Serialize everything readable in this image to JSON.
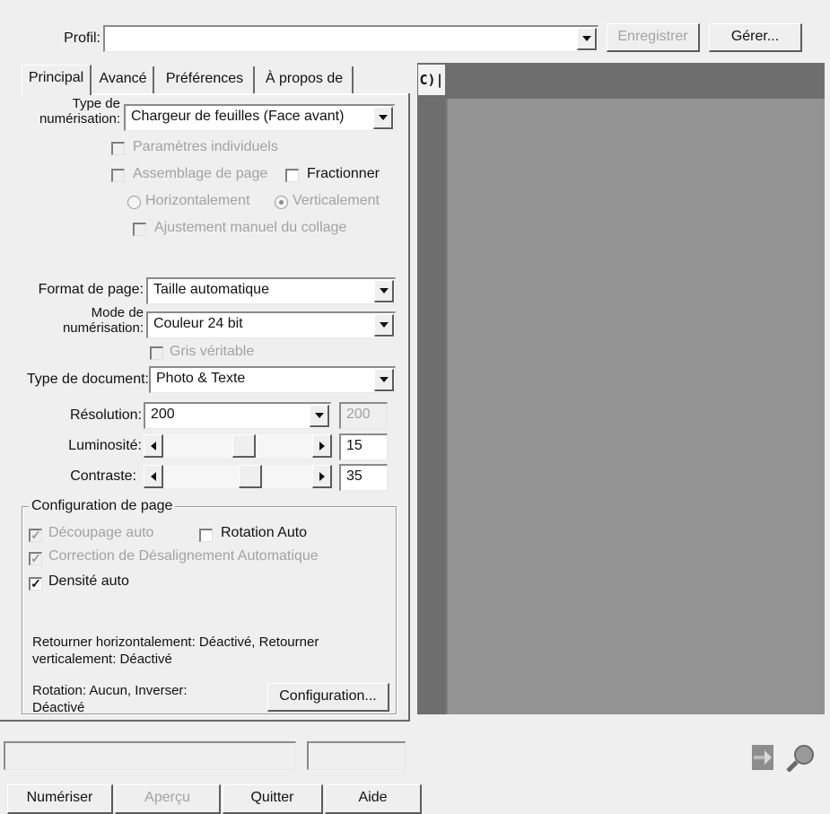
{
  "header": {
    "profile_label": "Profil:",
    "profile_value": "",
    "save_label": "Enregistrer",
    "manage_label": "Gérer..."
  },
  "tabs": [
    {
      "label": "Principal",
      "active": true
    },
    {
      "label": "Avancé",
      "active": false
    },
    {
      "label": "Préférences",
      "active": false
    },
    {
      "label": "À propos de",
      "active": false
    }
  ],
  "scan_type": {
    "label_line1": "Type de",
    "label_line2": "numérisation:",
    "value": "Chargeur de feuilles (Face avant)"
  },
  "options": {
    "individual_params": "Paramètres individuels",
    "page_assembly": "Assemblage de page",
    "split": "Fractionner",
    "horizontal": "Horizontalement",
    "vertical": "Verticalement",
    "manual_adjust": "Ajustement manuel du collage"
  },
  "page_format": {
    "label": "Format de page:",
    "value": "Taille automatique"
  },
  "scan_mode": {
    "label_line1": "Mode de",
    "label_line2": "numérisation:",
    "value": "Couleur 24 bit",
    "true_gray": "Gris véritable"
  },
  "document_type": {
    "label": "Type de document:",
    "value": "Photo & Texte"
  },
  "resolution": {
    "label": "Résolution:",
    "value": "200",
    "custom_value": "200"
  },
  "brightness": {
    "label": "Luminosité:",
    "value": "15",
    "slider_level": 0.55
  },
  "contrast": {
    "label": "Contraste:",
    "value": "35",
    "slider_level": 0.6
  },
  "page_config": {
    "title": "Configuration de page",
    "auto_crop": "Découpage auto",
    "auto_rotate": "Rotation Auto",
    "auto_deskew": "Correction de Désalignement Automatique",
    "auto_density": "Densité auto",
    "flip_line1": "Retourner horizontalement: Déactivé, Retourner",
    "flip_line2": "verticalement: Déactivé",
    "rotation_line1": "Rotation: Aucun, Inverser:",
    "rotation_line2": "Déactivé",
    "config_button": "Configuration..."
  },
  "preview": {
    "toolbar_icon": "unit-icon",
    "background": "#939393",
    "bar": "#6e6e6e"
  },
  "footer": {
    "scan_button": "Numériser",
    "preview_button": "Aperçu",
    "quit_button": "Quitter",
    "help_button": "Aide"
  }
}
